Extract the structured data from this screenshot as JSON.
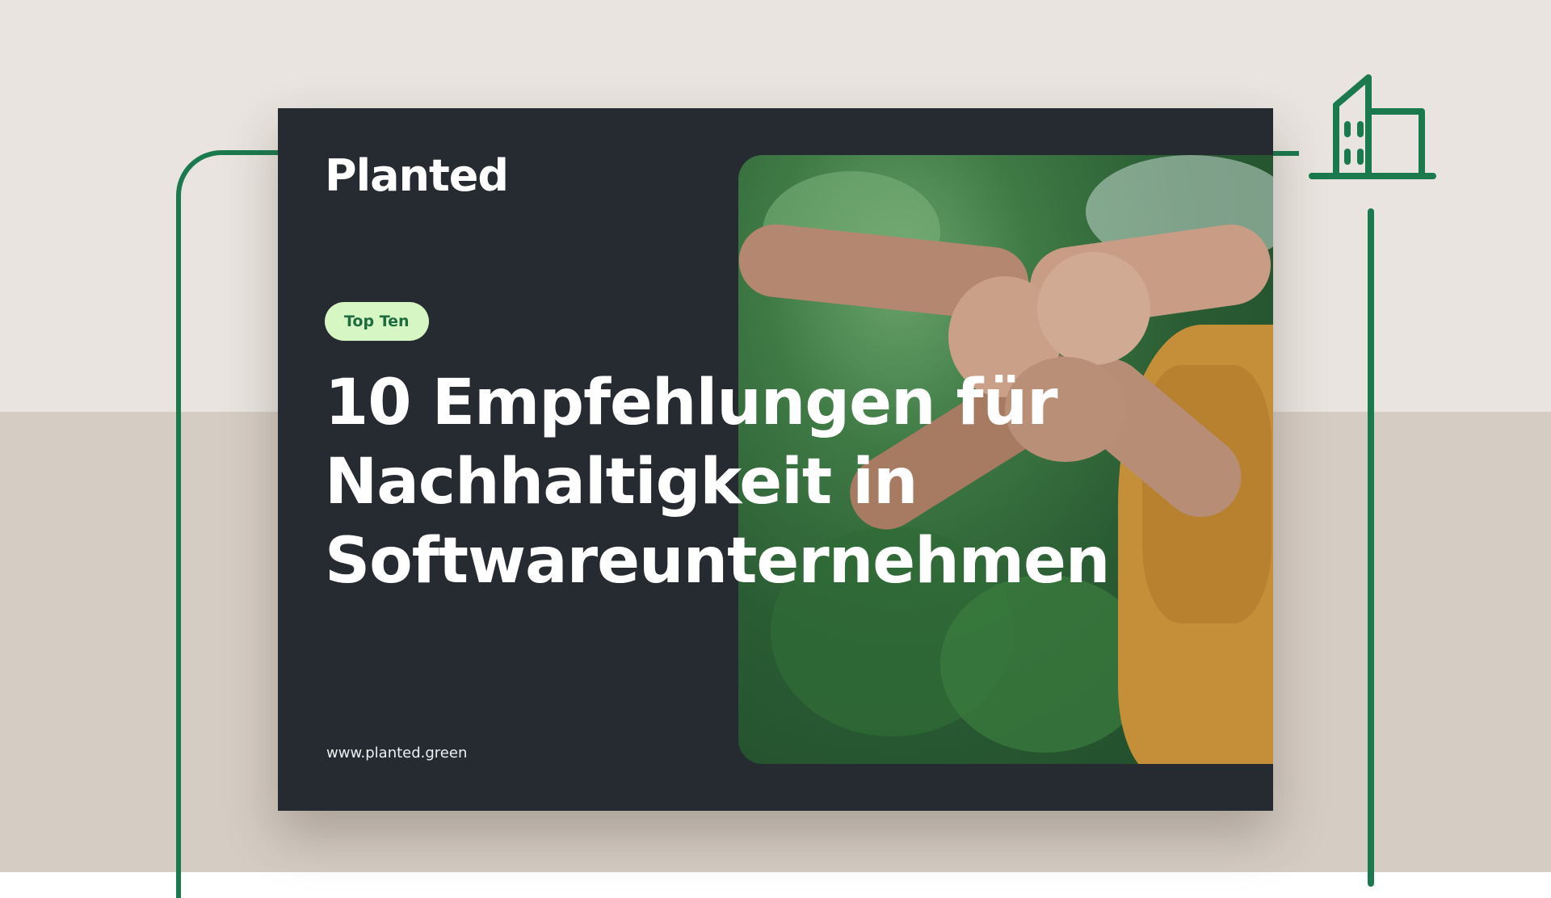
{
  "brand": {
    "logo_text": "Planted",
    "color": "#1a7a4e"
  },
  "card": {
    "badge": "Top Ten",
    "headline": "10 Empfehlungen für Nachhaltigkeit in Softwareunternehmen",
    "url": "www.planted.green"
  },
  "icons": {
    "building": "building-icon",
    "photo": "fist-bump-photo"
  }
}
